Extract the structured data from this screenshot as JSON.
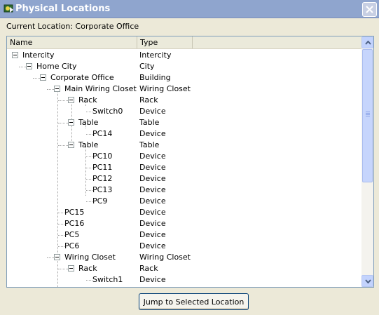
{
  "window": {
    "title": "Physical Locations",
    "close_symbol": "close-icon"
  },
  "current_location_text": "Current Location: Corporate Office",
  "columns": {
    "name": "Name",
    "type": "Type"
  },
  "tree": [
    {
      "name": "Intercity",
      "type": "Intercity"
    },
    {
      "name": "Home City",
      "type": "City"
    },
    {
      "name": "Corporate Office",
      "type": "Building"
    },
    {
      "name": "Main Wiring Closet",
      "type": "Wiring Closet"
    },
    {
      "name": "Rack",
      "type": "Rack"
    },
    {
      "name": "Switch0",
      "type": "Device"
    },
    {
      "name": "Table",
      "type": "Table"
    },
    {
      "name": "PC14",
      "type": "Device"
    },
    {
      "name": "Table",
      "type": "Table"
    },
    {
      "name": "PC10",
      "type": "Device"
    },
    {
      "name": "PC11",
      "type": "Device"
    },
    {
      "name": "PC12",
      "type": "Device"
    },
    {
      "name": "PC13",
      "type": "Device"
    },
    {
      "name": "PC9",
      "type": "Device"
    },
    {
      "name": "PC15",
      "type": "Device"
    },
    {
      "name": "PC16",
      "type": "Device"
    },
    {
      "name": "PC5",
      "type": "Device"
    },
    {
      "name": "PC6",
      "type": "Device"
    },
    {
      "name": "Wiring Closet",
      "type": "Wiring Closet"
    },
    {
      "name": "Rack",
      "type": "Rack"
    },
    {
      "name": "Switch1",
      "type": "Device"
    }
  ],
  "jump_button_label": "Jump to Selected Location",
  "colors": {
    "titlebar": "#8fa5ce",
    "dialog_bg": "#ece9d8",
    "panel_border": "#7f9db9",
    "scrollbar_button": "#c3d3fd"
  }
}
